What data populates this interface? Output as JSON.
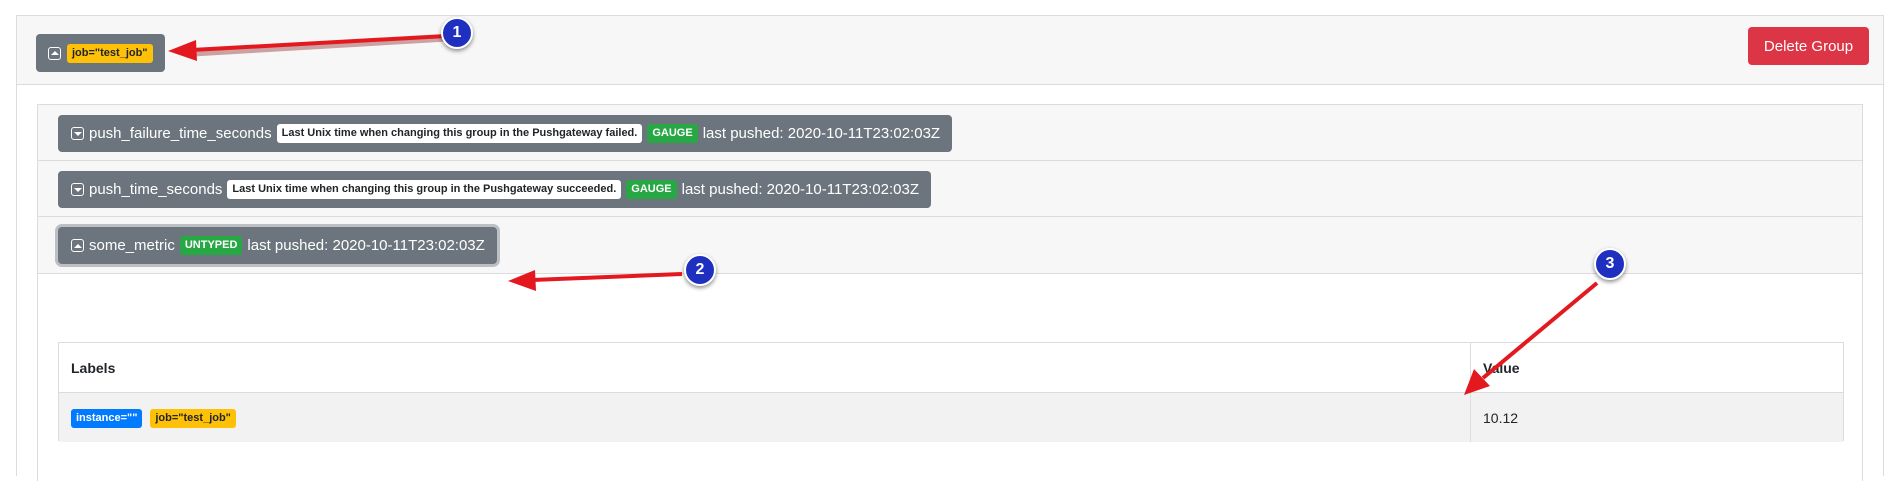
{
  "group": {
    "label_badge": "job=\"test_job\"",
    "delete_label": "Delete Group"
  },
  "metrics": [
    {
      "name": "push_failure_time_seconds",
      "help": "Last Unix time when changing this group in the Pushgateway failed.",
      "type": "GAUGE",
      "last_pushed": "last pushed: 2020-10-11T23:02:03Z"
    },
    {
      "name": "push_time_seconds",
      "help": "Last Unix time when changing this group in the Pushgateway succeeded.",
      "type": "GAUGE",
      "last_pushed": "last pushed: 2020-10-11T23:02:03Z"
    },
    {
      "name": "some_metric",
      "type": "UNTYPED",
      "last_pushed": "last pushed: 2020-10-11T23:02:03Z"
    }
  ],
  "table": {
    "headers": [
      "Labels",
      "Value"
    ],
    "rows": [
      {
        "labels": [
          "instance=\"\"",
          "job=\"test_job\""
        ],
        "value": "10.12"
      }
    ]
  },
  "annotations": [
    "1",
    "2",
    "3"
  ],
  "colors": {
    "header_bg": "#6c757d",
    "delete": "#dc3545",
    "badge_warning": "#ffc107",
    "badge_primary": "#007bff",
    "badge_success": "#28a745",
    "marker": "#1f2fbf",
    "arrow": "#e3191f"
  }
}
